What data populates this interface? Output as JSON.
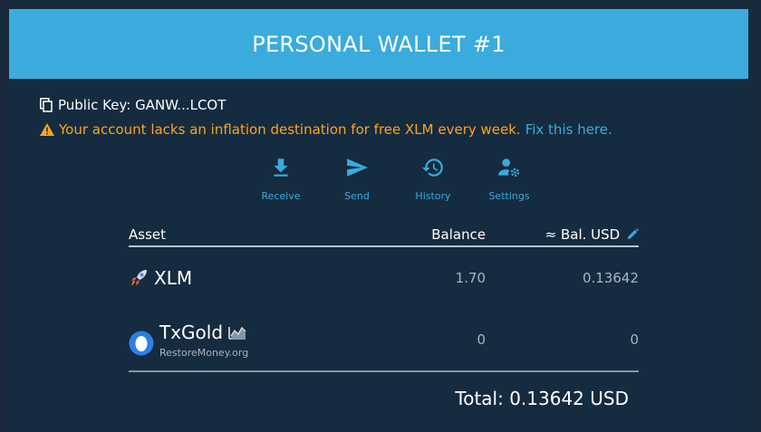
{
  "header": {
    "title": "PERSONAL WALLET #1"
  },
  "account": {
    "public_key_label": "Public Key: GANW...LCOT",
    "warning_text": "Your account lacks an inflation destination for free XLM every week.",
    "warning_link": "Fix this here."
  },
  "actions": [
    {
      "label": "Receive",
      "icon": "download-icon"
    },
    {
      "label": "Send",
      "icon": "send-icon"
    },
    {
      "label": "History",
      "icon": "history-icon"
    },
    {
      "label": "Settings",
      "icon": "user-settings-icon"
    }
  ],
  "table": {
    "headers": {
      "asset": "Asset",
      "balance": "Balance",
      "usd": "≈ Bal. USD"
    },
    "rows": [
      {
        "name": "XLM",
        "sub": "",
        "balance": "1.70",
        "usd": "0.13642"
      },
      {
        "name": "TxGold",
        "sub": "RestoreMoney.org",
        "balance": "0",
        "usd": "0"
      }
    ]
  },
  "total": "Total: 0.13642 USD",
  "colors": {
    "accent": "#3aabdc",
    "warning": "#ffa41c",
    "background": "#152b40"
  }
}
